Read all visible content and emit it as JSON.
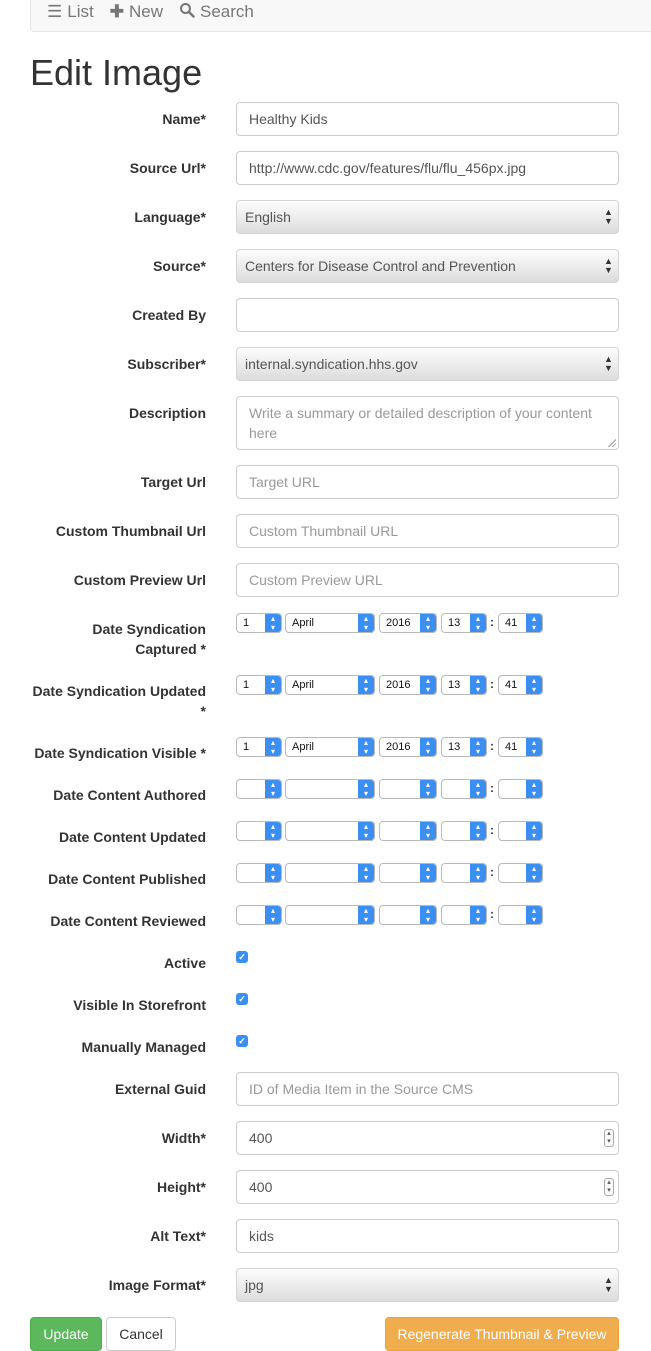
{
  "nav": {
    "list_label": "List",
    "list_icon": "list-icon",
    "new_label": "New",
    "new_icon": "plus-icon",
    "search_label": "Search",
    "search_icon": "search-icon"
  },
  "title": "Edit Image",
  "fields": {
    "name": {
      "label": "Name*",
      "value": "Healthy Kids"
    },
    "source_url": {
      "label": "Source Url*",
      "value": "http://www.cdc.gov/features/flu/flu_456px.jpg"
    },
    "language": {
      "label": "Language*",
      "value": "English"
    },
    "source": {
      "label": "Source*",
      "value": "Centers for Disease Control and Prevention"
    },
    "created_by": {
      "label": "Created By",
      "value": ""
    },
    "subscriber": {
      "label": "Subscriber*",
      "value": "internal.syndication.hhs.gov"
    },
    "description": {
      "label": "Description",
      "placeholder": "Write a summary or detailed description of your content here"
    },
    "target_url": {
      "label": "Target Url",
      "placeholder": "Target URL"
    },
    "custom_thumbnail_url": {
      "label": "Custom Thumbnail Url",
      "placeholder": "Custom Thumbnail URL"
    },
    "custom_preview_url": {
      "label": "Custom Preview Url",
      "placeholder": "Custom Preview URL"
    },
    "external_guid": {
      "label": "External Guid",
      "placeholder": "ID of Media Item in the Source CMS"
    },
    "width": {
      "label": "Width*",
      "value": "400"
    },
    "height": {
      "label": "Height*",
      "value": "400"
    },
    "alt_text": {
      "label": "Alt Text*",
      "value": "kids"
    },
    "image_format": {
      "label": "Image Format*",
      "value": "jpg"
    }
  },
  "dates": {
    "captured": {
      "label1": "Date Syndication",
      "label2": "Captured *",
      "day": "1",
      "month": "April",
      "year": "2016",
      "hour": "13",
      "minute": "41"
    },
    "updated": {
      "label1": "Date Syndication Updated",
      "label2": "*",
      "day": "1",
      "month": "April",
      "year": "2016",
      "hour": "13",
      "minute": "41"
    },
    "visible": {
      "label": "Date Syndication Visible *",
      "day": "1",
      "month": "April",
      "year": "2016",
      "hour": "13",
      "minute": "41"
    },
    "content_authored": {
      "label": "Date Content Authored"
    },
    "content_updated": {
      "label": "Date Content Updated"
    },
    "content_published": {
      "label": "Date Content Published"
    },
    "content_reviewed": {
      "label": "Date Content Reviewed"
    },
    "separator": ":"
  },
  "checkboxes": {
    "active": {
      "label": "Active",
      "checked": true
    },
    "visible_in_storefront": {
      "label": "Visible In Storefront",
      "checked": true
    },
    "manually_managed": {
      "label": "Manually Managed",
      "checked": true
    }
  },
  "buttons": {
    "update": "Update",
    "cancel": "Cancel",
    "regenerate": "Regenerate Thumbnail & Preview"
  },
  "colors": {
    "primary": "#3b8ff3",
    "success": "#5cb85c",
    "warning": "#f0ad4e"
  }
}
